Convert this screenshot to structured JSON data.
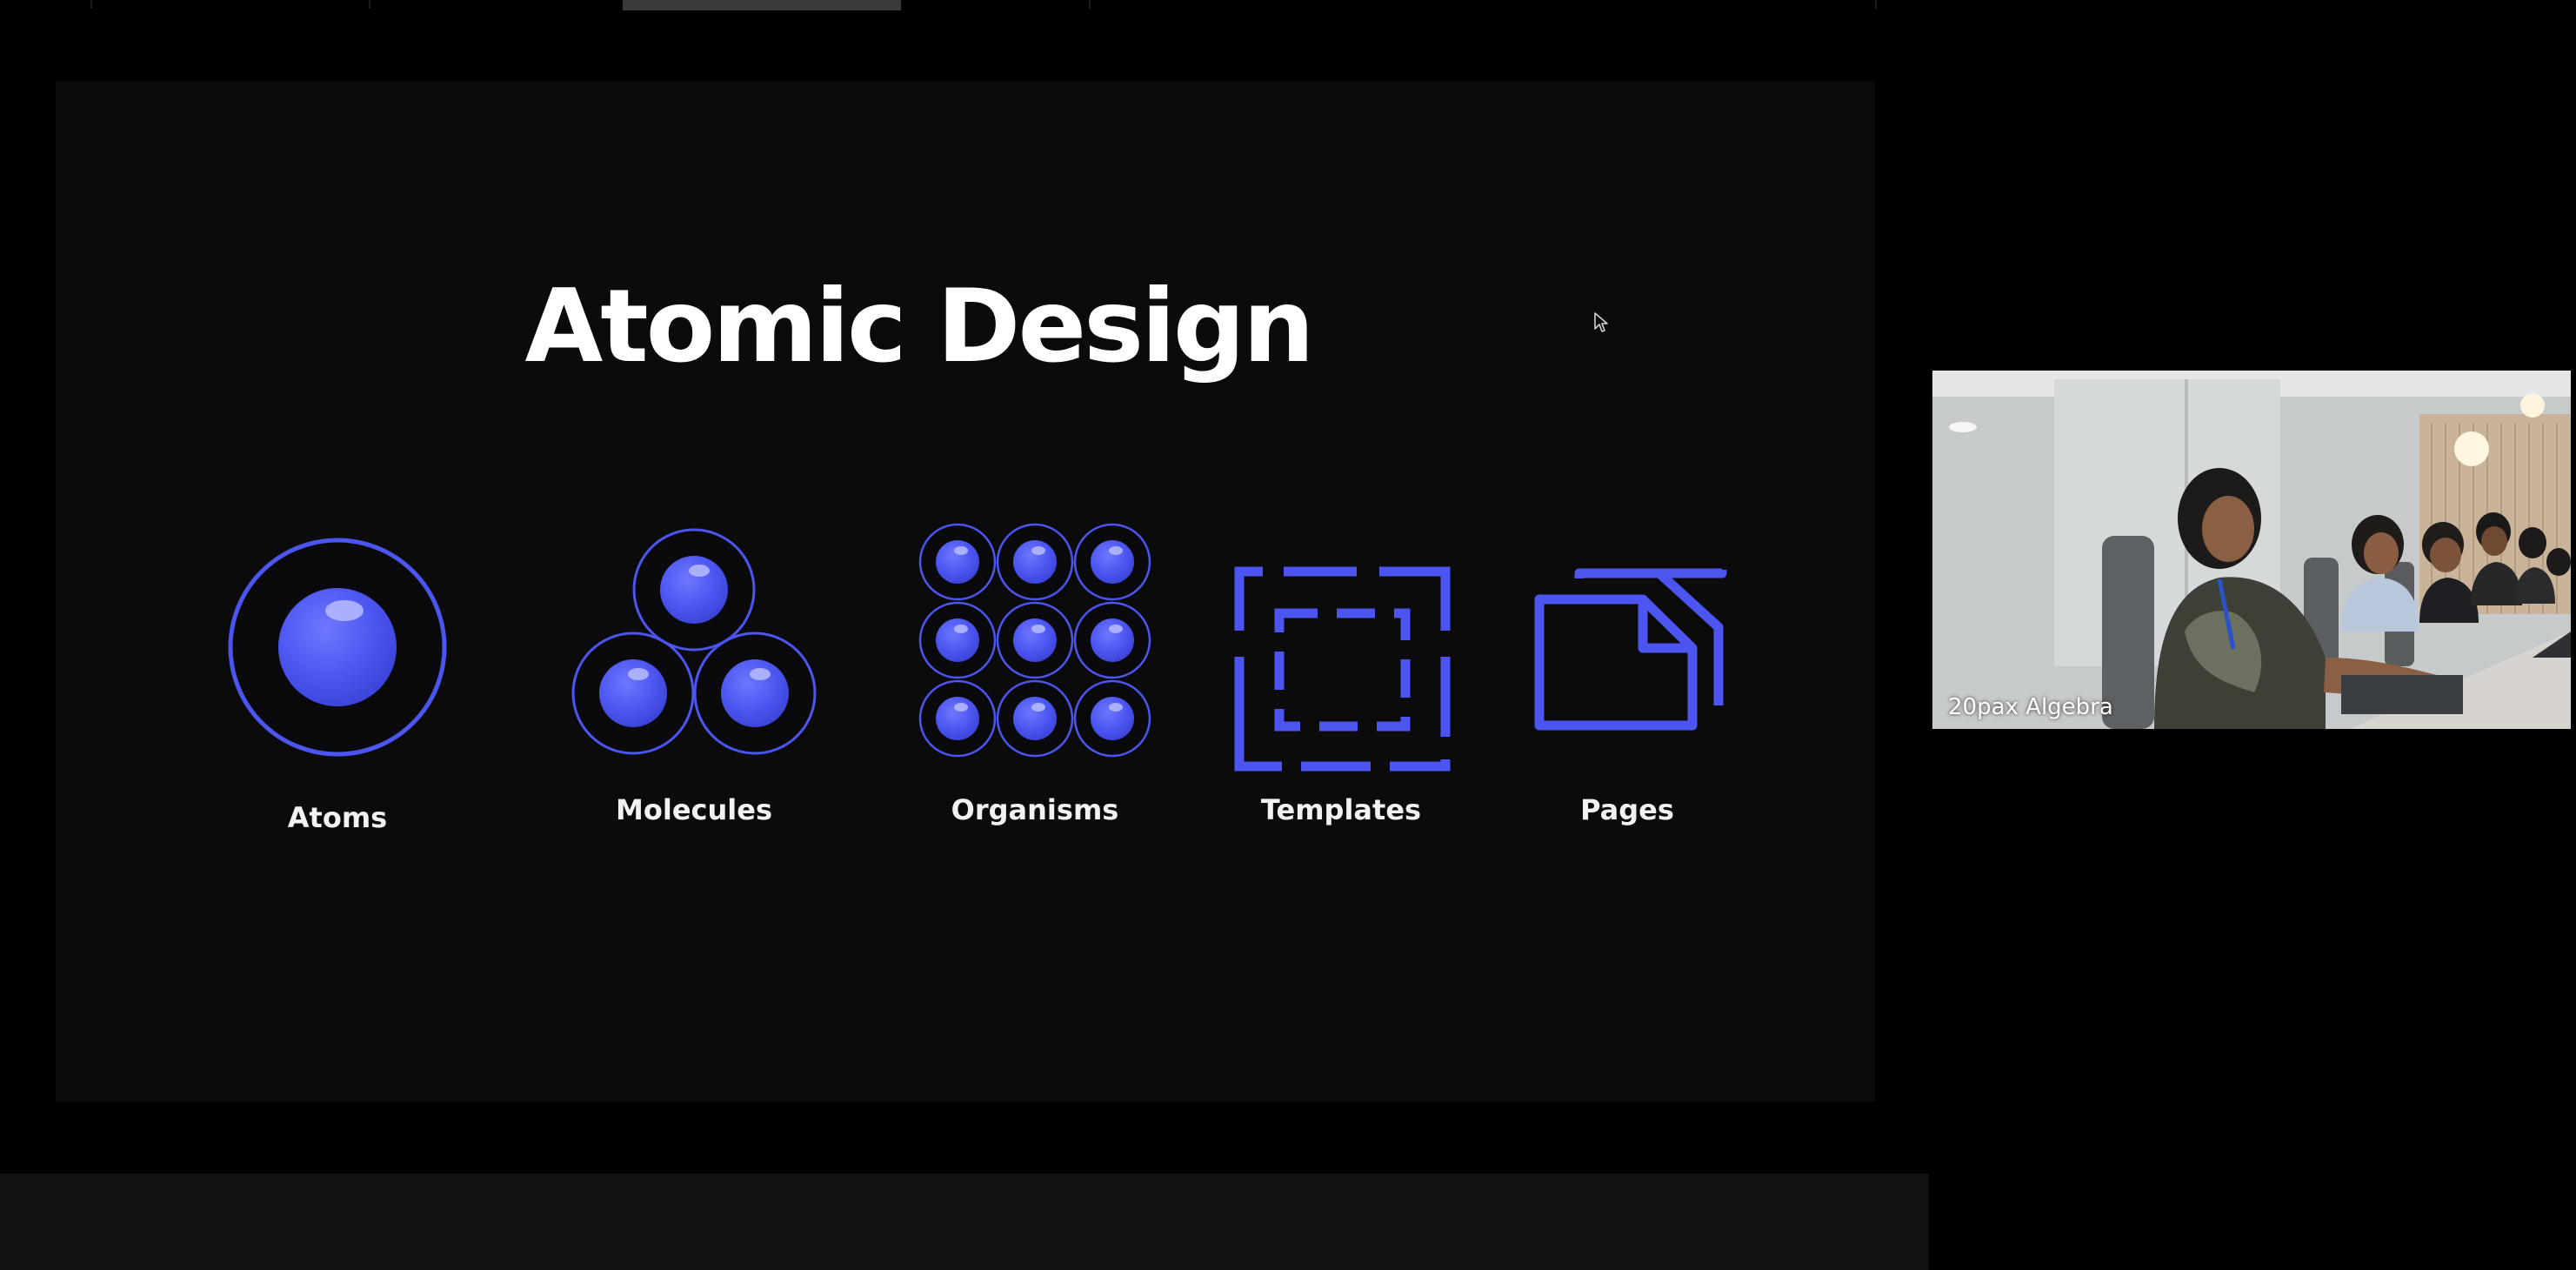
{
  "presentation": {
    "slide_title": "Atomic Design",
    "items": [
      {
        "label": "Atoms",
        "icon": "atom-icon"
      },
      {
        "label": "Molecules",
        "icon": "molecule-icon"
      },
      {
        "label": "Organisms",
        "icon": "organism-grid-icon"
      },
      {
        "label": "Templates",
        "icon": "template-frame-icon"
      },
      {
        "label": "Pages",
        "icon": "pages-icon"
      }
    ],
    "accent_color": "#4c55f0",
    "slide_background": "#0b0b0c"
  },
  "participant_video": {
    "name": "20pax Algebra"
  }
}
